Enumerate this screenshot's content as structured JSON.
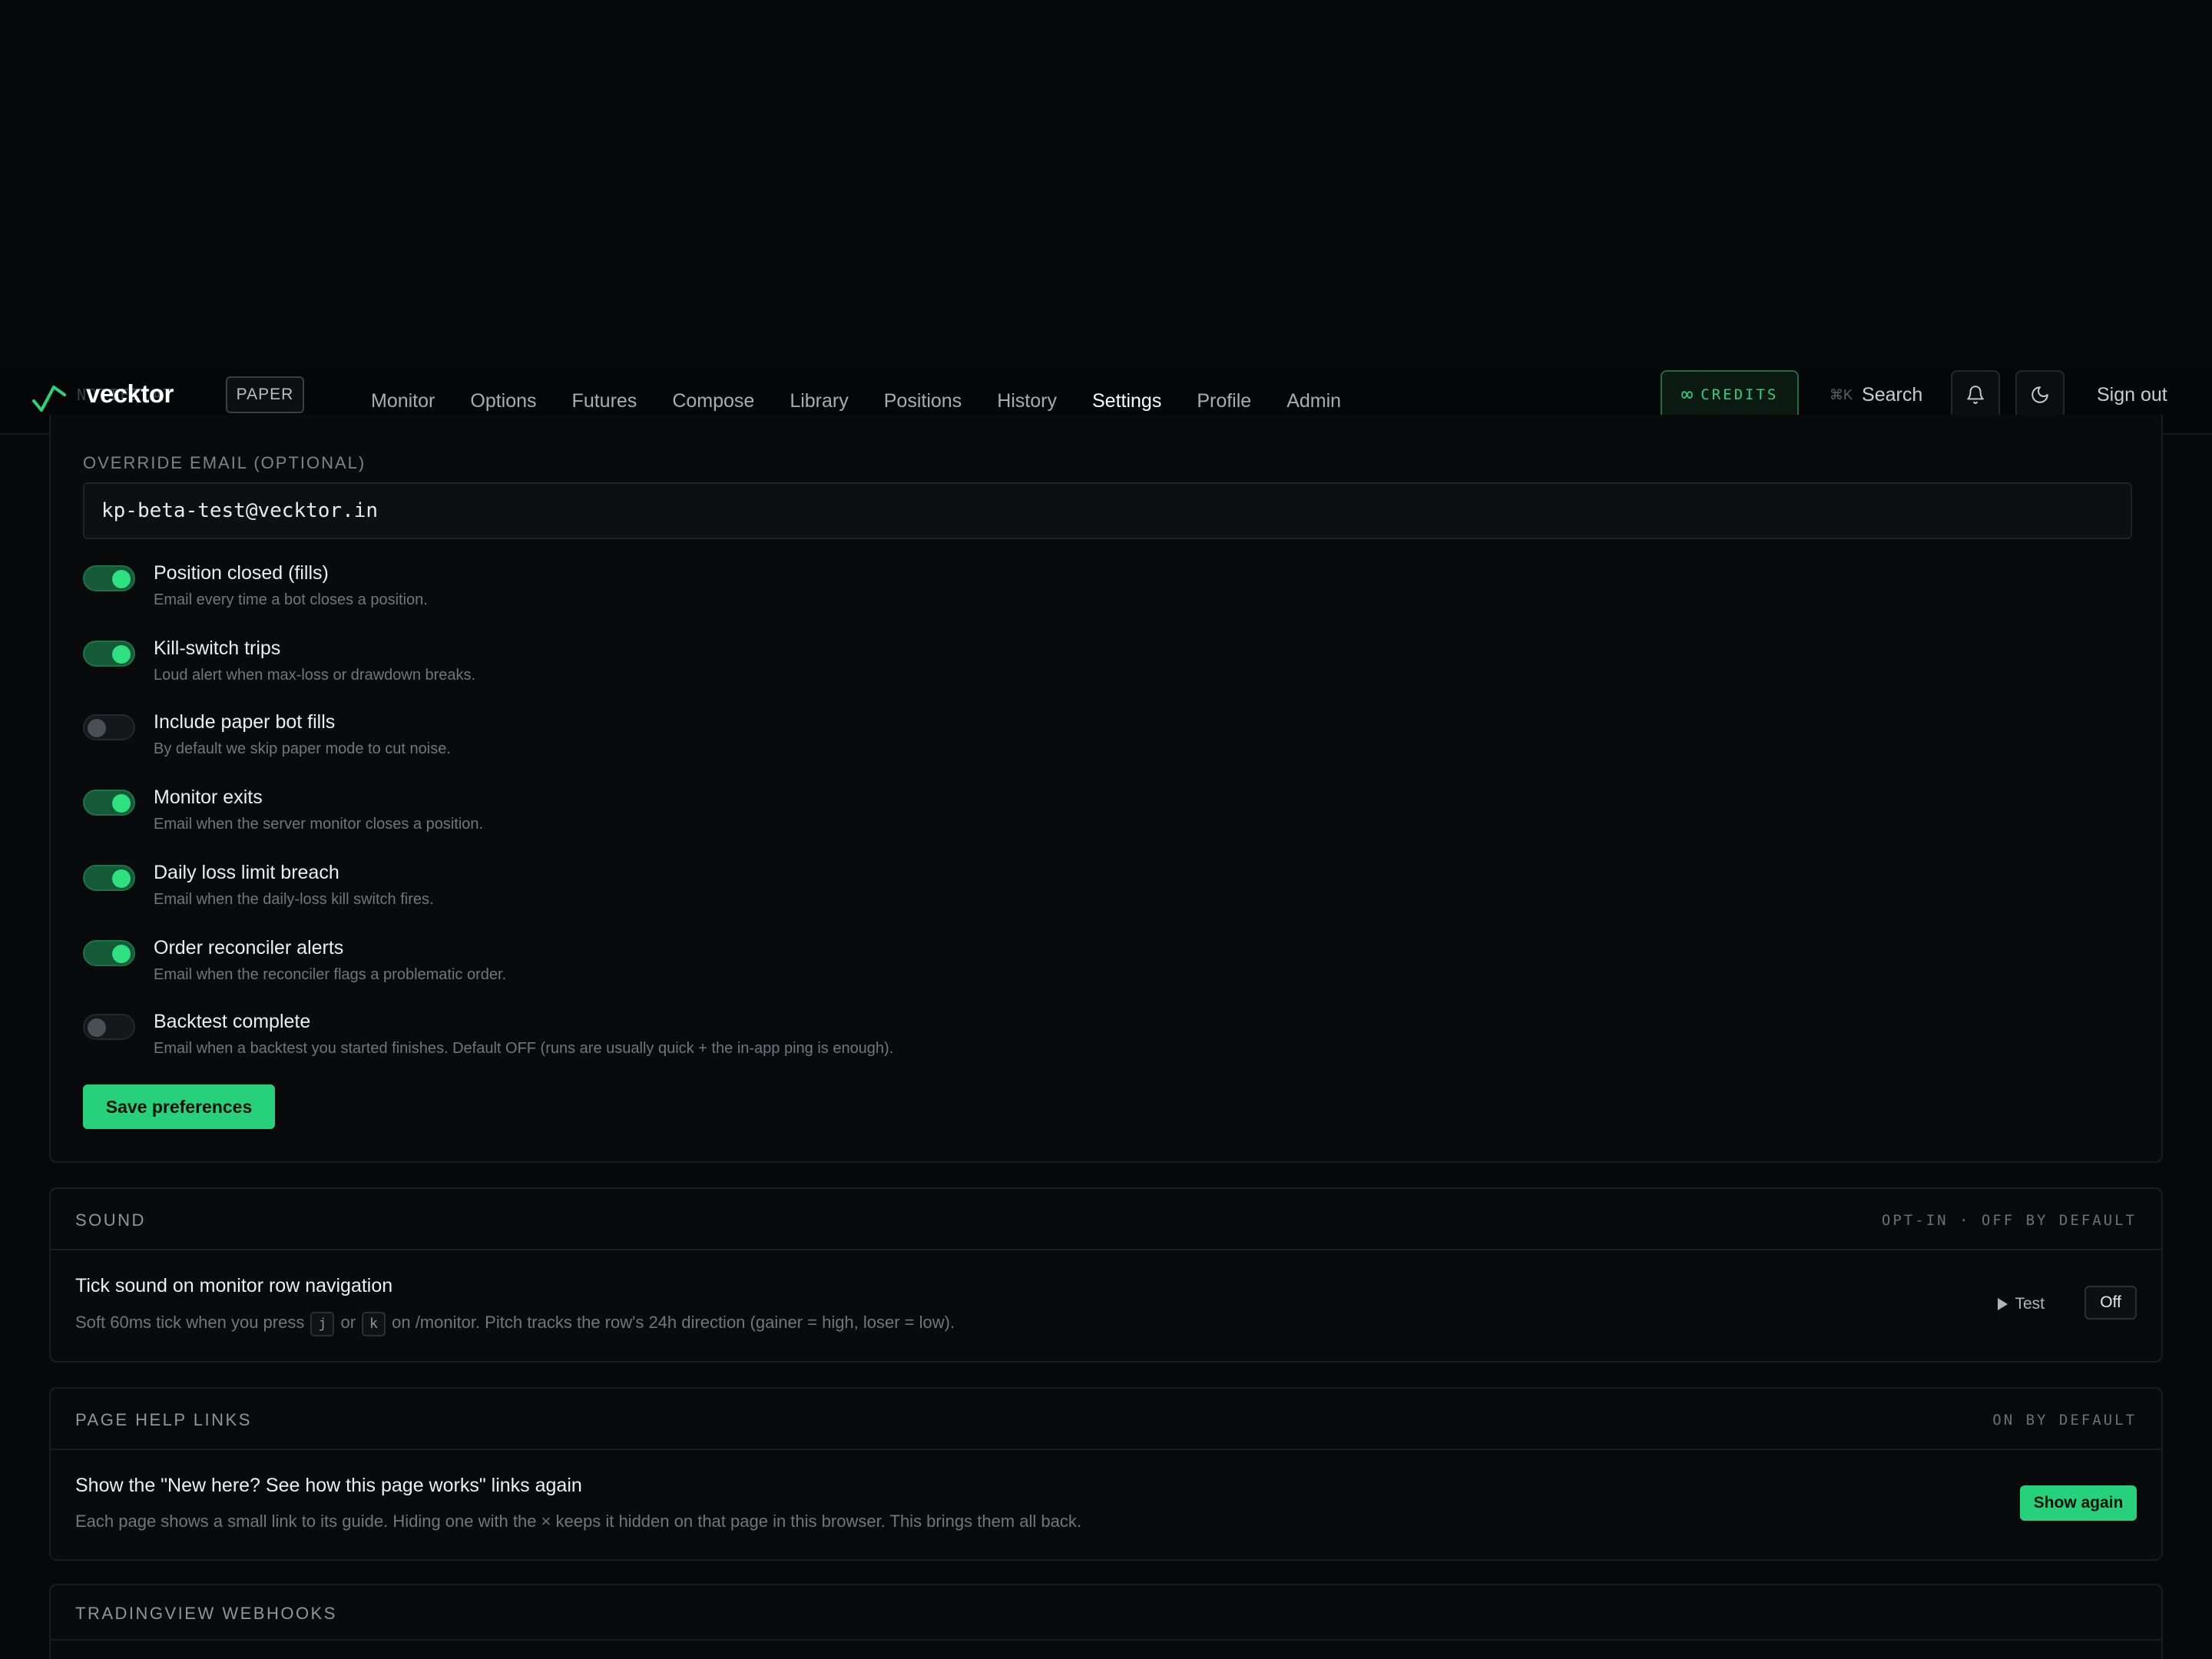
{
  "topbar": {
    "brand": "vecktor",
    "behind_label": "NOTIFICAT",
    "mode_badge": "PAPER",
    "nav": [
      {
        "label": "Monitor",
        "active": false
      },
      {
        "label": "Options",
        "active": false
      },
      {
        "label": "Futures",
        "active": false
      },
      {
        "label": "Compose",
        "active": false
      },
      {
        "label": "Library",
        "active": false
      },
      {
        "label": "Positions",
        "active": false
      },
      {
        "label": "History",
        "active": false
      },
      {
        "label": "Settings",
        "active": true
      },
      {
        "label": "Profile",
        "active": false
      },
      {
        "label": "Admin",
        "active": false
      }
    ],
    "credits_symbol": "∞",
    "credits_label": "CREDITS",
    "search_kbd": "⌘K",
    "search_label": "Search",
    "signout_label": "Sign out",
    "accent_color": "#22c670"
  },
  "notifications": {
    "override_label": "OVERRIDE EMAIL (OPTIONAL)",
    "override_value": "kp-beta-test@vecktor.in",
    "prefs": [
      {
        "title": "Position closed (fills)",
        "desc": "Email every time a bot closes a position.",
        "on": true
      },
      {
        "title": "Kill-switch trips",
        "desc": "Loud alert when max-loss or drawdown breaks.",
        "on": true
      },
      {
        "title": "Include paper bot fills",
        "desc": "By default we skip paper mode to cut noise.",
        "on": false
      },
      {
        "title": "Monitor exits",
        "desc": "Email when the server monitor closes a position.",
        "on": true
      },
      {
        "title": "Daily loss limit breach",
        "desc": "Email when the daily-loss kill switch fires.",
        "on": true
      },
      {
        "title": "Order reconciler alerts",
        "desc": "Email when the reconciler flags a problematic order.",
        "on": true
      },
      {
        "title": "Backtest complete",
        "desc": "Email when a backtest you started finishes. Default OFF (runs are usually quick + the in-app ping is enough).",
        "on": false
      }
    ],
    "save_label": "Save preferences"
  },
  "sound": {
    "title": "SOUND",
    "meta": "OPT-IN · OFF BY DEFAULT",
    "row_title": "Tick sound on monitor row navigation",
    "desc_1": "Soft 60ms tick when you press",
    "key_1": "j",
    "desc_or": "or",
    "key_2": "k",
    "desc_2": "on /monitor. Pitch tracks the row's 24h direction (gainer = high, loser = low).",
    "test_label": "Test",
    "off_label": "Off"
  },
  "help_links": {
    "title": "PAGE HELP LINKS",
    "meta": "ON BY DEFAULT",
    "row_title": "Show the \"New here? See how this page works\" links again",
    "desc": "Each page shows a small link to its guide. Hiding one with the × keeps it hidden on that page in this browser. This brings them all back.",
    "button_label": "Show again"
  },
  "tradingview": {
    "title": "TRADINGVIEW WEBHOOKS"
  }
}
